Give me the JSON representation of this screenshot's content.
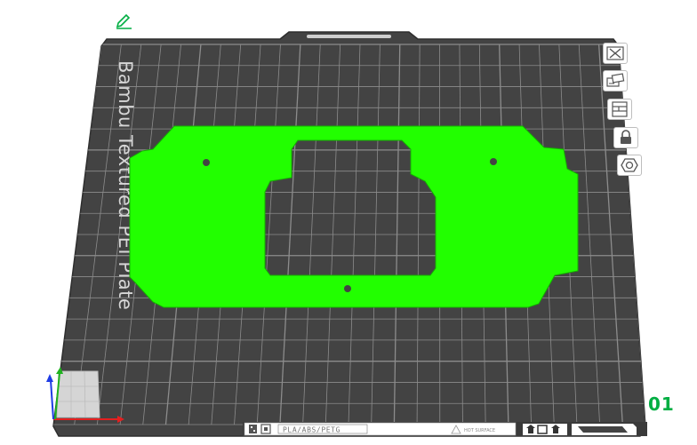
{
  "plate": {
    "name": "Bambu Textured PEI Plate",
    "index": "01",
    "filament_label": "PLA/ABS/PETG",
    "warning_label": "HOT SURFACE"
  },
  "toolbar": {
    "buttons": [
      {
        "name": "remove-plate-button",
        "icon": "close-icon"
      },
      {
        "name": "arrange-button",
        "icon": "arrange-icon"
      },
      {
        "name": "layout-button",
        "icon": "layout-icon"
      },
      {
        "name": "lock-plate-button",
        "icon": "lock-icon"
      },
      {
        "name": "plate-settings-button",
        "icon": "hex-nut-icon"
      }
    ]
  },
  "colors": {
    "plate_bg": "#434343",
    "grid_line": "#8c8c8c",
    "model": "#22ff00",
    "accent": "#00ae42",
    "axis_x": "#e51f1f",
    "axis_y": "#1fb31f",
    "axis_z": "#1f3ce5"
  }
}
